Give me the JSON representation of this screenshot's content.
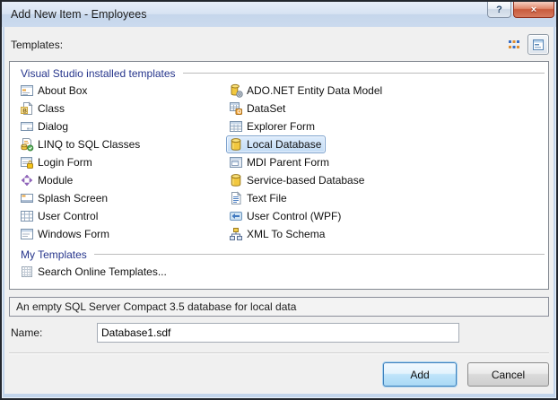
{
  "titlebar": {
    "title": "Add New Item - Employees",
    "help_glyph": "?",
    "close_glyph": "×"
  },
  "toolbar": {
    "label": "Templates:",
    "view_buttons": [
      {
        "icon": "small-icons-view",
        "selected": false
      },
      {
        "icon": "details-view",
        "selected": true
      }
    ]
  },
  "templates": {
    "sections": [
      {
        "title": "Visual Studio installed templates",
        "items": [
          {
            "label": "About Box",
            "icon": "about-form",
            "selected": false
          },
          {
            "label": "ADO.NET Entity Data Model",
            "icon": "ado-entity",
            "selected": false
          },
          {
            "label": "Class",
            "icon": "class-vb",
            "selected": false
          },
          {
            "label": "DataSet",
            "icon": "dataset",
            "selected": false
          },
          {
            "label": "Dialog",
            "icon": "dialog",
            "selected": false
          },
          {
            "label": "Explorer Form",
            "icon": "explorer-form",
            "selected": false
          },
          {
            "label": "LINQ to SQL Classes",
            "icon": "linq-sql",
            "selected": false
          },
          {
            "label": "Local Database",
            "icon": "database",
            "selected": true
          },
          {
            "label": "Login Form",
            "icon": "login-form",
            "selected": false
          },
          {
            "label": "MDI Parent Form",
            "icon": "mdi-form",
            "selected": false
          },
          {
            "label": "Module",
            "icon": "module",
            "selected": false
          },
          {
            "label": "Service-based Database",
            "icon": "database",
            "selected": false
          },
          {
            "label": "Splash Screen",
            "icon": "splash",
            "selected": false
          },
          {
            "label": "Text File",
            "icon": "text-file",
            "selected": false
          },
          {
            "label": "User Control",
            "icon": "user-control",
            "selected": false
          },
          {
            "label": "User Control (WPF)",
            "icon": "wpf-control",
            "selected": false
          },
          {
            "label": "Windows Form",
            "icon": "windows-form",
            "selected": false
          },
          {
            "label": "XML To Schema",
            "icon": "xml-schema",
            "selected": false
          }
        ]
      },
      {
        "title": "My Templates",
        "items": [
          {
            "label": "Search Online Templates...",
            "icon": "search-online",
            "selected": false
          }
        ]
      }
    ]
  },
  "selected_template": "Local Database",
  "description": "An empty SQL Server Compact 3.5 database for local data",
  "name_field": {
    "label": "Name:",
    "value": "Database1.sdf"
  },
  "buttons": {
    "add": "Add",
    "cancel": "Cancel"
  },
  "colors": {
    "header_blue": "#26358c",
    "selection_border": "#7da2ce",
    "selection_fill": "#c3dcf5",
    "close_button_red": "#c85a3c",
    "dialog_bg": "#f0f0f0",
    "frame_blue": "#c3d5eb"
  }
}
